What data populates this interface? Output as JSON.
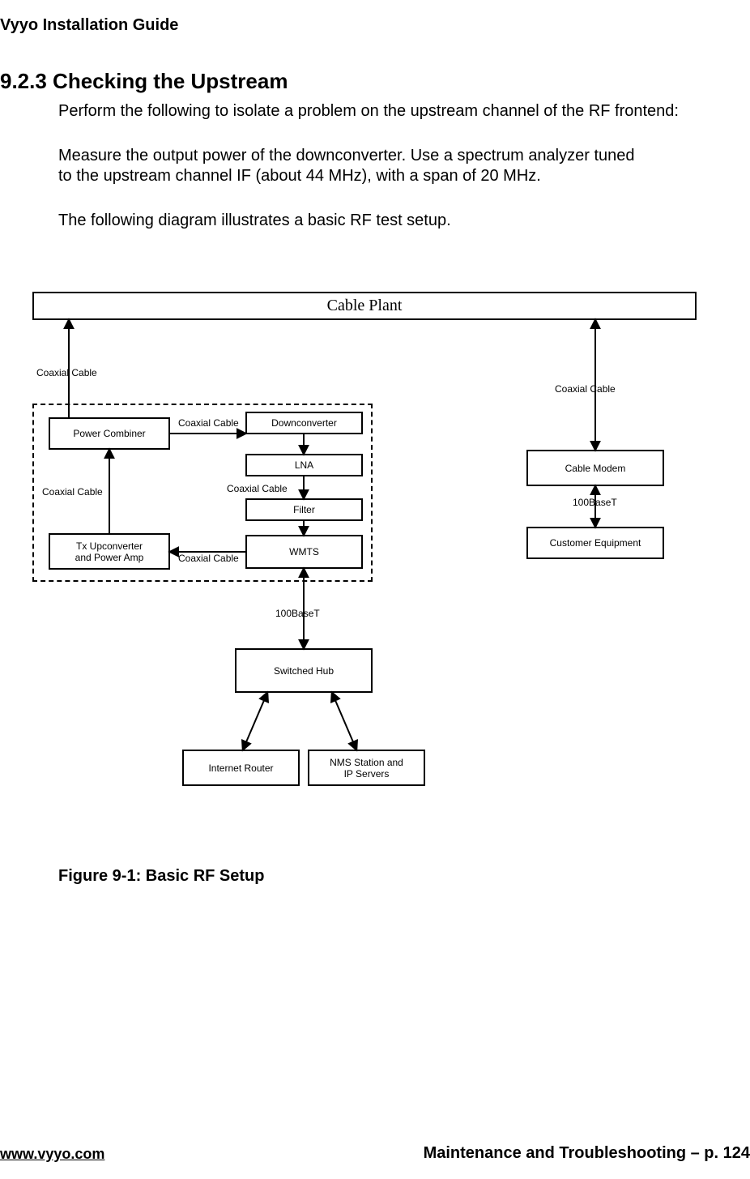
{
  "header": {
    "running_title": "Vyyo Installation Guide"
  },
  "section": {
    "number": "9.2.3",
    "title": "Checking the Upstream",
    "heading_full": "9.2.3  Checking the Upstream",
    "p1": "Perform the following to isolate a problem on the upstream channel of the RF frontend:",
    "p2": "Measure the output power of the downconverter.  Use a spectrum analyzer tuned to the upstream channel IF (about 44 MHz), with a span of 20 MHz.",
    "p3": "The following diagram illustrates a basic RF test setup."
  },
  "diagram": {
    "title": "Cable Plant",
    "boxes": {
      "power_combiner": "Power Combiner",
      "downconverter": "Downconverter",
      "lna": "LNA",
      "filter": "Filter",
      "wmts": "WMTS",
      "tx_upconverter": "Tx  Upconverter\nand Power Amp",
      "switched_hub": "Switched Hub",
      "internet_router": "Internet Router",
      "nms_station": "NMS Station and\nIP Servers",
      "cable_modem": "Cable Modem",
      "customer_equipment": "Customer Equipment"
    },
    "labels": {
      "coaxial_cable": "Coaxial Cable",
      "hundred_base_t": "100BaseT"
    }
  },
  "caption": "Figure 9-1: Basic RF Setup",
  "footer": {
    "url": "www.vyyo.com",
    "right": "Maintenance and Troubleshooting – p. 124"
  }
}
